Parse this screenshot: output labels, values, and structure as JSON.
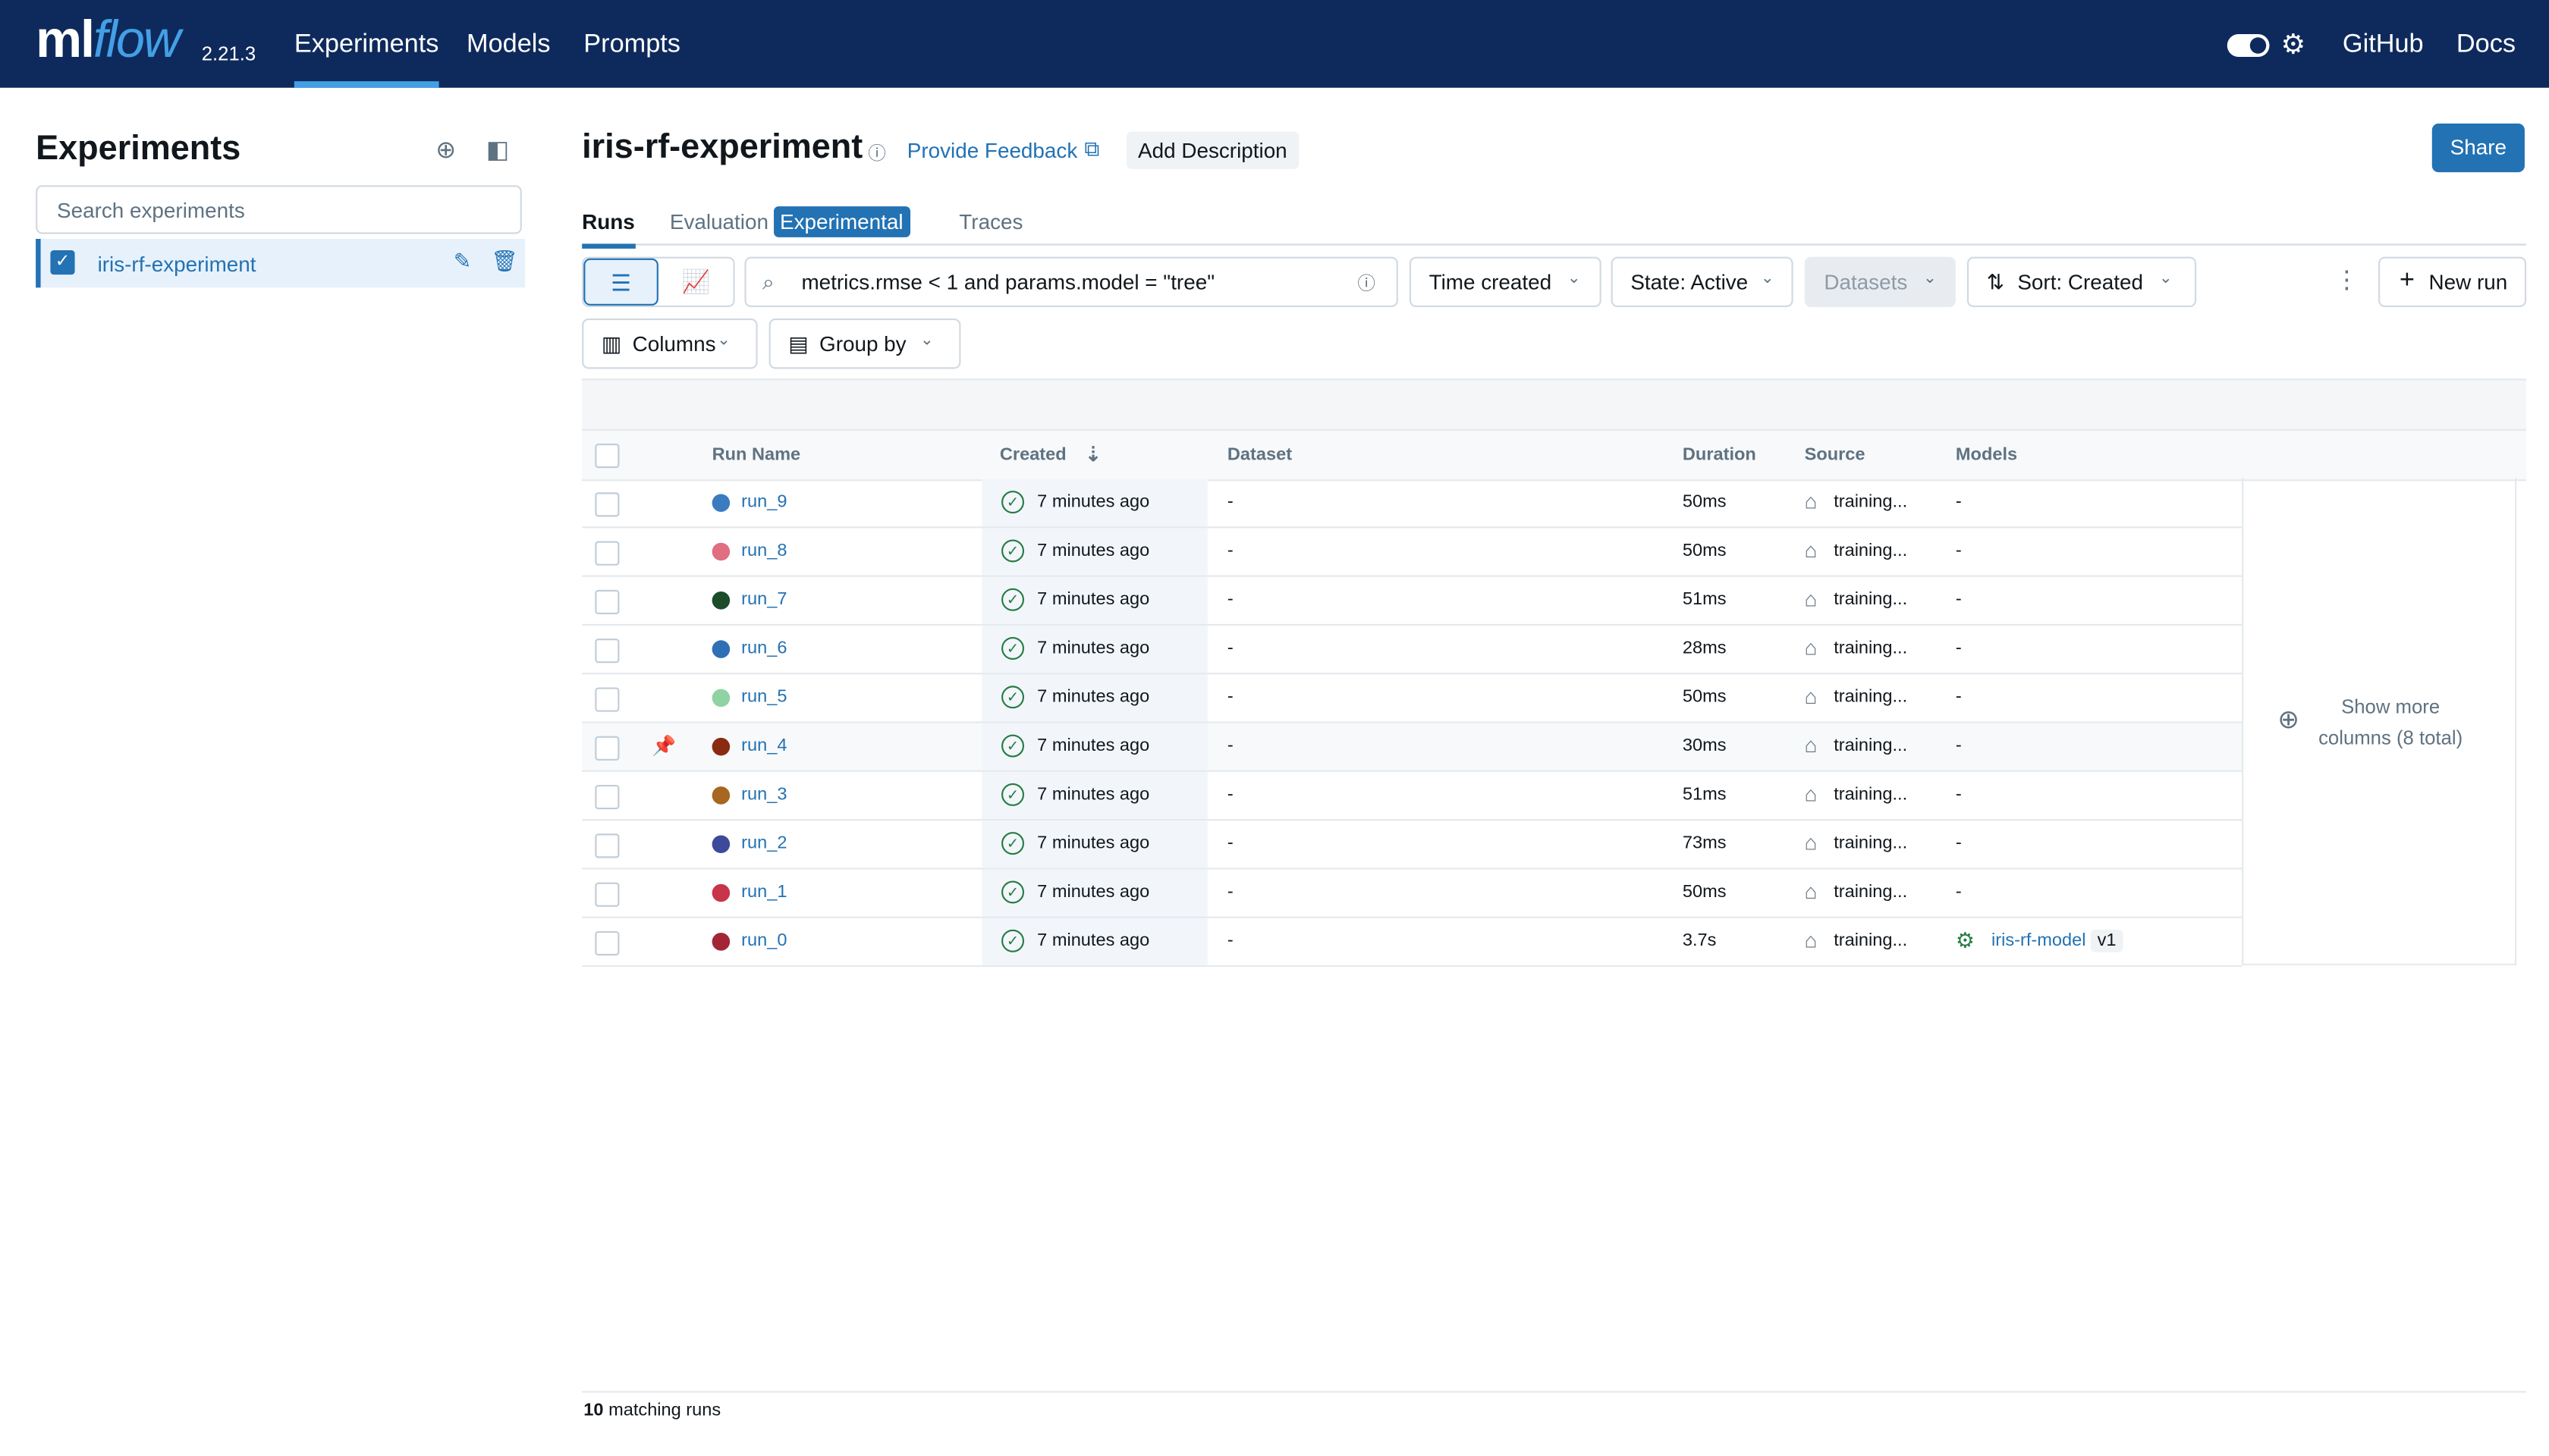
{
  "nav": {
    "logo_ml": "ml",
    "logo_flow": "flow",
    "version": "2.21.3",
    "links": [
      "Experiments",
      "Models",
      "Prompts"
    ],
    "github": "GitHub",
    "docs": "Docs"
  },
  "sidebar": {
    "title": "Experiments",
    "search_placeholder": "Search experiments",
    "experiment": "iris-rf-experiment"
  },
  "header": {
    "title": "iris-rf-experiment",
    "feedback": "Provide Feedback",
    "add_description": "Add Description",
    "share": "Share"
  },
  "tabs": {
    "runs": "Runs",
    "evaluation": "Evaluation",
    "badge": "Experimental",
    "traces": "Traces"
  },
  "toolbar": {
    "search_value": "metrics.rmse < 1 and params.model = \"tree\"",
    "time_created": "Time created",
    "state": "State: Active",
    "datasets": "Datasets",
    "sort": "Sort: Created",
    "new_run": "New run",
    "columns": "Columns",
    "group_by": "Group by"
  },
  "table": {
    "headers": {
      "run_name": "Run Name",
      "created": "Created",
      "dataset": "Dataset",
      "duration": "Duration",
      "source": "Source",
      "models": "Models"
    },
    "rows": [
      {
        "name": "run_9",
        "created": "7 minutes ago",
        "dataset": "-",
        "duration": "50ms",
        "source": "training...",
        "models": "-",
        "color": "#3b7bbf"
      },
      {
        "name": "run_8",
        "created": "7 minutes ago",
        "dataset": "-",
        "duration": "50ms",
        "source": "training...",
        "models": "-",
        "color": "#e06d80"
      },
      {
        "name": "run_7",
        "created": "7 minutes ago",
        "dataset": "-",
        "duration": "51ms",
        "source": "training...",
        "models": "-",
        "color": "#1b4d2a"
      },
      {
        "name": "run_6",
        "created": "7 minutes ago",
        "dataset": "-",
        "duration": "28ms",
        "source": "training...",
        "models": "-",
        "color": "#2f6fb6"
      },
      {
        "name": "run_5",
        "created": "7 minutes ago",
        "dataset": "-",
        "duration": "50ms",
        "source": "training...",
        "models": "-",
        "color": "#8fd3a3"
      },
      {
        "name": "run_4",
        "created": "7 minutes ago",
        "dataset": "-",
        "duration": "30ms",
        "source": "training...",
        "models": "-",
        "color": "#8a2a12"
      },
      {
        "name": "run_3",
        "created": "7 minutes ago",
        "dataset": "-",
        "duration": "51ms",
        "source": "training...",
        "models": "-",
        "color": "#a86620"
      },
      {
        "name": "run_2",
        "created": "7 minutes ago",
        "dataset": "-",
        "duration": "73ms",
        "source": "training...",
        "models": "-",
        "color": "#3d4a9a"
      },
      {
        "name": "run_1",
        "created": "7 minutes ago",
        "dataset": "-",
        "duration": "50ms",
        "source": "training...",
        "models": "-",
        "color": "#c8344a"
      },
      {
        "name": "run_0",
        "created": "7 minutes ago",
        "dataset": "-",
        "duration": "3.7s",
        "source": "training...",
        "models": "iris-rf-model",
        "model_version": "v1",
        "color": "#a32637"
      }
    ],
    "show_more_1": "Show more",
    "show_more_2": "columns (8 total)"
  },
  "footer": {
    "count": "10",
    "label": "matching runs"
  }
}
